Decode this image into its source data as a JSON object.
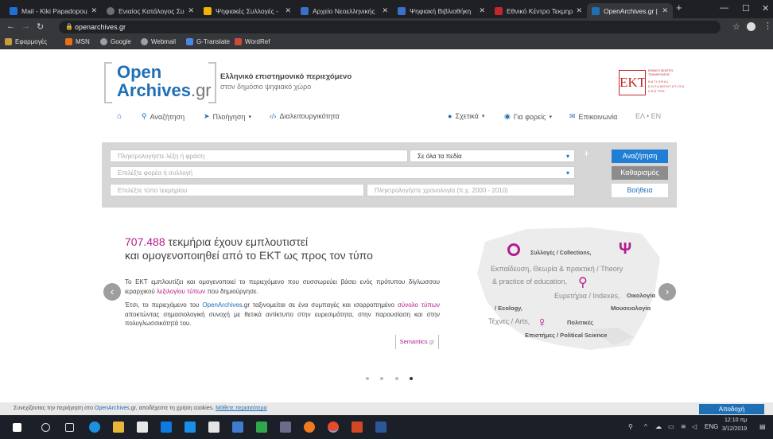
{
  "browser": {
    "tabs": [
      {
        "label": "Mail - Kiki Papadopoul",
        "color": "#1d6fd6"
      },
      {
        "label": "Ενιαίος Κατάλογος Συ",
        "color": "#6b6f76"
      },
      {
        "label": "Ψηφιακές Συλλογές -",
        "color": "#f5b301"
      },
      {
        "label": "Αρχείο Νεοελληνικής",
        "color": "#3a70c9"
      },
      {
        "label": "Ψηφιακή Βιβλιοθήκη",
        "color": "#3a70c9"
      },
      {
        "label": "Εθνικό Κέντρο Τεκμηρ",
        "color": "#c2272d"
      },
      {
        "label": "OpenArchives.gr | Ο",
        "color": "#1f6fb5"
      }
    ],
    "url": "openarchives.gr",
    "bookmarks": [
      {
        "label": "Εφαρμογές",
        "color": "#c89b3c"
      },
      {
        "label": "MSN",
        "color": "#e8701a"
      },
      {
        "label": "Google",
        "color": "#9aa0a6"
      },
      {
        "label": "Webmail",
        "color": "#9aa0a6"
      },
      {
        "label": "G-Translate",
        "color": "#4a86e8"
      },
      {
        "label": "WordRef",
        "color": "#d04a3a"
      }
    ]
  },
  "header": {
    "logo_open": "Open",
    "logo_archives": "Archives",
    "logo_gr": ".gr",
    "slogan_line1": "Ελληνικό επιστημονικό περιεχόμενο",
    "slogan_line2": "στον δημόσιο ψηφιακό χώρο",
    "ekt_letters": "EKT",
    "ekt_greek": "ΕΘΝΙΚΟ ΚΕΝΤΡΟ ΤΕΚΜΗΡΙΩΣΗΣ",
    "ekt_english": "NATIONAL DOCUMENTATION CENTRE"
  },
  "nav": {
    "search": "Αναζήτηση",
    "browse": "Πλοήγηση",
    "interop": "Διαλειτουργικότητα",
    "about": "Σχετικά",
    "providers": "Για φορείς",
    "contact": "Επικοινωνία",
    "lang": "ΕΛ • EN"
  },
  "search": {
    "keyword_placeholder": "Πληκτρολογήστε λέξη ή φράση",
    "field_select": "Σε όλα τα πεδία",
    "provider_placeholder": "Επιλέξτε φορέα ή συλλογή",
    "type_placeholder": "Επιλέξτε τύπο τεκμηρίου",
    "year_placeholder": "Πληκτρολογήστε χρονολογία (π.χ. 2000 - 2010)",
    "search_btn": "Αναζήτηση",
    "clear_btn": "Καθαρισμός",
    "help_btn": "Βοήθεια"
  },
  "hero": {
    "count": "707.488",
    "headline_rest": "τεκμήρια έχουν εμπλουτιστεί",
    "headline_line2": "και ομογενοποιηθεί από το ΕΚΤ ως προς τον τύπο",
    "p1": "Το ΕΚΤ εμπλουτίζει και ομογενοποιεί το περιεχόμενο που συσσωρεύει βάσει ενός πρότυπου δίγλωσσου ιεραρχικού",
    "p1_link": "λεξιλογίου τύπων",
    "p1_end": "που δημιούργησε.",
    "p2_start": "Έτσι, το περιεχόμενο του",
    "p2_link1": "OpenArchives",
    "p2_mid": ".gr ταξινομείται σε ένα συμπαγές και ισορροπημένο",
    "p2_link2": "σύνολο τύπων",
    "p2_end": "αποκτώντας σημασιολογική συνοχή με θετικά αντίκτυπο στην ευρεσιμότητα, στην παρουσίαση και στην πολυγλωσσικότητά του.",
    "semantics": "Semantics",
    "semantics_gr": ".gr"
  },
  "map_words": {
    "w1": "Συλλογές / Collections,",
    "w2": "Εκπαίδευση, Θεωρία & πρακτική / Theory",
    "w3": "& practice of education,",
    "w4": "Ευρετήρια / Indexes,",
    "w5": "Οικολογία",
    "w6": "/ Ecology,",
    "w7": "Μουσειολογία",
    "w8": "Τέχνες / Arts,",
    "w9": "Πολιτικές",
    "w10": "Επιστήμες / Political Science"
  },
  "cookie": {
    "text_start": "Συνεχίζοντας την περιήγηση στο",
    "link": "OpenArchives",
    "text_end": ".gr, αποδέχεστε τη χρήση cookies.",
    "more": "Μάθετε περισσότερα",
    "accept": "Αποδοχή"
  },
  "taskbar": {
    "lang": "ENG",
    "time": "12:10 πμ",
    "date": "3/12/2019"
  }
}
